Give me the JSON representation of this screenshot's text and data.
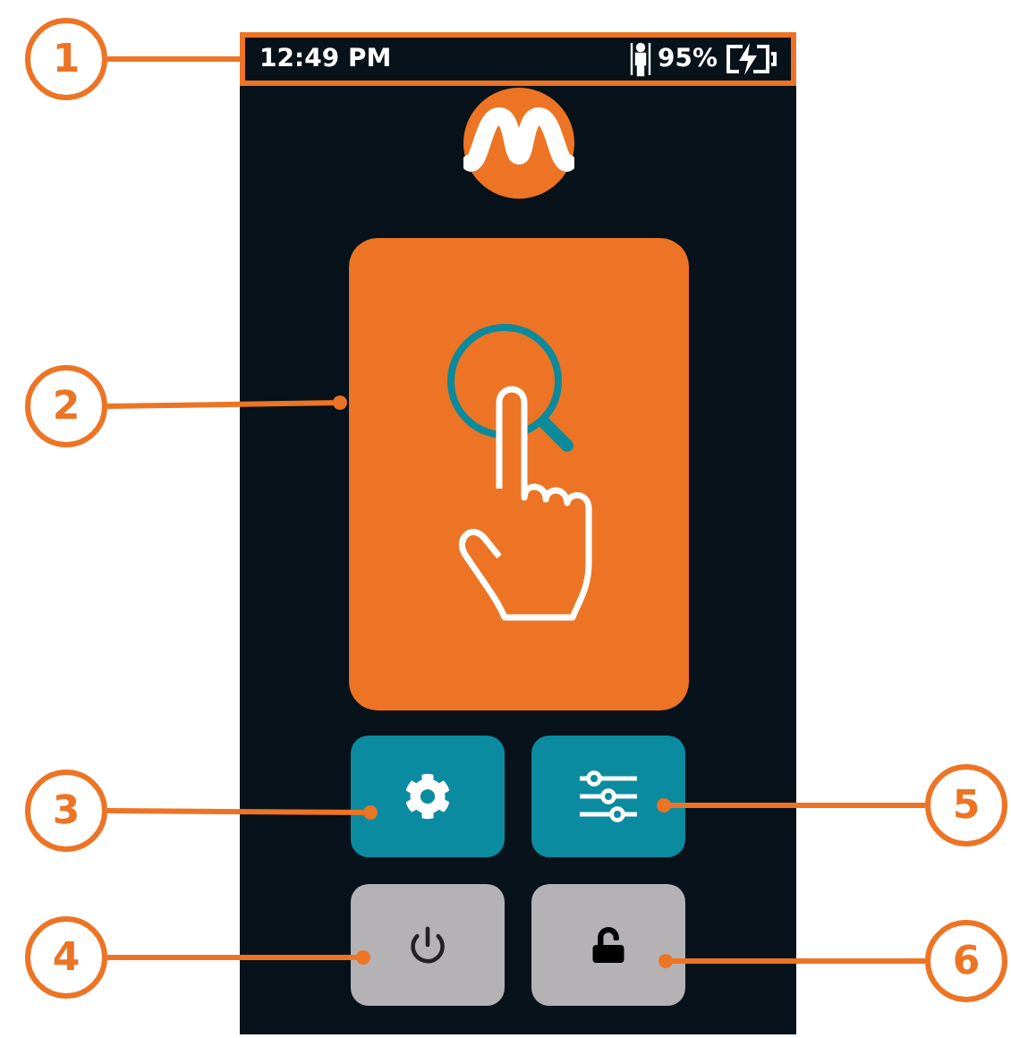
{
  "status_bar": {
    "time": "12:49 PM",
    "battery": "95%"
  },
  "buttons": [
    {
      "kind": "settings"
    },
    {
      "kind": "adjust"
    },
    {
      "kind": "power"
    },
    {
      "kind": "unlock"
    }
  ],
  "callouts": [
    {
      "label": "1"
    },
    {
      "label": "2"
    },
    {
      "label": "3"
    },
    {
      "label": "4"
    },
    {
      "label": "5"
    },
    {
      "label": "6"
    }
  ]
}
